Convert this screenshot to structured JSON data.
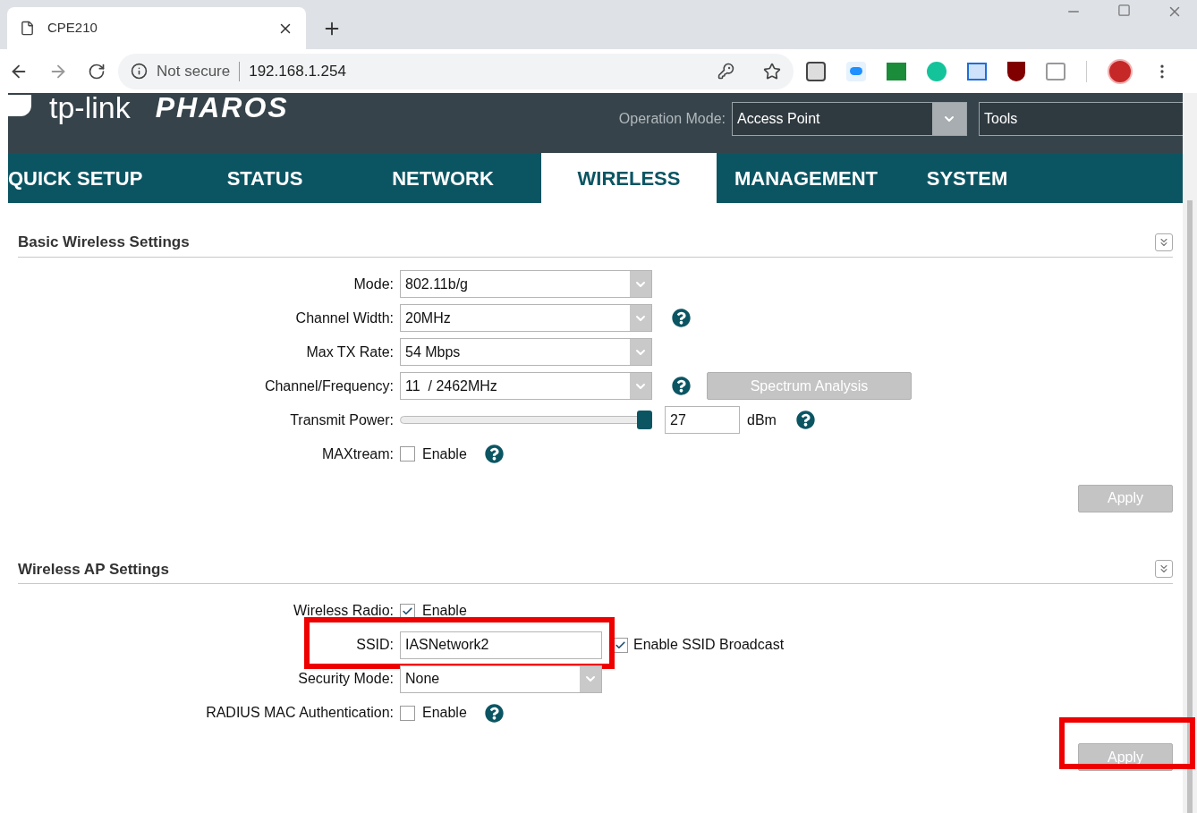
{
  "browser": {
    "tab_title": "CPE210",
    "security": "Not secure",
    "url": "192.168.1.254"
  },
  "header": {
    "logo": "tp-link",
    "product": "PHAROS",
    "operation_mode_label": "Operation Mode:",
    "operation_mode": "Access Point",
    "tools": "Tools"
  },
  "nav": [
    {
      "label": "QUICK SETUP",
      "selected": false
    },
    {
      "label": "STATUS",
      "selected": false
    },
    {
      "label": "NETWORK",
      "selected": false
    },
    {
      "label": "WIRELESS",
      "selected": true
    },
    {
      "label": "MANAGEMENT",
      "selected": false
    },
    {
      "label": "SYSTEM",
      "selected": false
    }
  ],
  "sections": [
    {
      "title": "Basic Wireless Settings",
      "apply": "Apply",
      "apply_highlighted": false,
      "rows": [
        {
          "kind": "select",
          "label": "Mode:",
          "value": "802.11b/g",
          "help": false,
          "highlighted": false
        },
        {
          "kind": "select",
          "label": "Channel Width:",
          "value": "20MHz",
          "help": true,
          "highlighted": false
        },
        {
          "kind": "select",
          "label": "Max TX Rate:",
          "value": "54 Mbps",
          "help": false,
          "highlighted": false
        },
        {
          "kind": "select",
          "label": "Channel/Frequency:",
          "value": "11  / 2462MHz",
          "help": true,
          "button": "Spectrum Analysis",
          "highlighted": false
        },
        {
          "kind": "slider",
          "label": "Transmit Power:",
          "level": 0.97,
          "value": "27",
          "unit": "dBm",
          "help": true,
          "highlighted": false
        },
        {
          "kind": "checkbox",
          "label": "MAXtream:",
          "checked": false,
          "text": "Enable",
          "help": true,
          "highlighted": false
        }
      ]
    },
    {
      "title": "Wireless AP Settings",
      "apply": "Apply",
      "apply_highlighted": true,
      "rows": [
        {
          "kind": "checkbox",
          "label": "Wireless Radio:",
          "checked": true,
          "text": "Enable",
          "help": false,
          "highlighted": false
        },
        {
          "kind": "text",
          "label": "SSID:",
          "value": "IASNetwork2",
          "checked": true,
          "text": "Enable SSID Broadcast",
          "highlighted": true
        },
        {
          "kind": "select",
          "label": "Security Mode:",
          "value": "None",
          "help": false,
          "narrow": true,
          "highlighted": false
        },
        {
          "kind": "checkbox",
          "label": "RADIUS MAC Authentication:",
          "checked": false,
          "text": "Enable",
          "help": true,
          "highlighted": false
        }
      ]
    }
  ]
}
